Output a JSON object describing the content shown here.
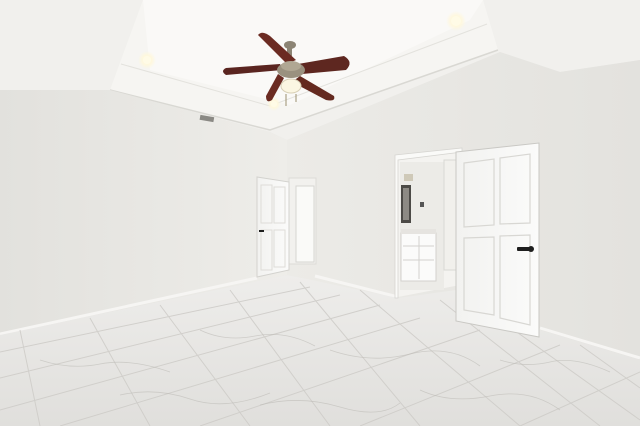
{
  "scene": {
    "type": "photograph",
    "subject": "empty-bedroom-interior",
    "colors": {
      "ceiling": "#f2f1ee",
      "tray_ceiling": "#f8f7f4",
      "left_wall": "#ecebe8",
      "right_wall": "#e7e6e3",
      "floor": "#e4e3e1",
      "floor_vein": "#b9b7b3",
      "grout": "#c9c7c3",
      "door": "#f6f6f4",
      "door_panel_shadow": "#d8d7d3",
      "fan_blade": "#6b2b22",
      "fan_metal": "#8c8474",
      "handle": "#1e1e1e",
      "recessed_light": "#fffbe6"
    },
    "objects": [
      "tray-ceiling",
      "ceiling-fan",
      "recessed-lights",
      "hvac-vent",
      "open-door-left",
      "open-door-right",
      "bathroom-vanity",
      "bathroom-mirror",
      "marble-tile-floor",
      "baseboards"
    ]
  }
}
